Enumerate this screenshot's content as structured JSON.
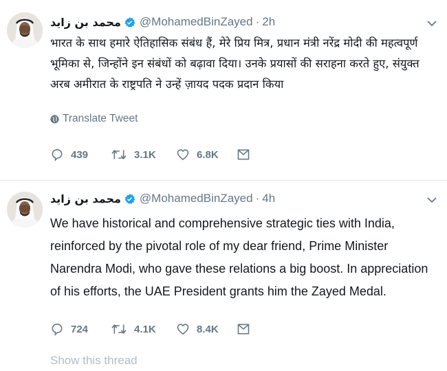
{
  "tweets": [
    {
      "name": "محمد بن زايد",
      "handle": "@MohamedBinZayed",
      "time": "2h",
      "text": "भारत के साथ हमारे ऐतिहासिक संबंध हैं, मेरे प्रिय मित्र, प्रधान मंत्री नरेंद्र मोदी की महत्वपूर्ण भूमिका से, जिन्होंने इन संबंधों को बढ़ावा दिया। उनके प्रयासों की सराहना करते हुए, संयुक्त अरब अमीरात के राष्ट्रपति ने उन्हें ज़ायद पदक प्रदान किया",
      "translate_label": "Translate Tweet",
      "replies": "439",
      "retweets": "3.1K",
      "likes": "6.8K"
    },
    {
      "name": "محمد بن زايد",
      "handle": "@MohamedBinZayed",
      "time": "4h",
      "text": "We have historical and comprehensive strategic ties with India, reinforced by the pivotal role of my dear friend, Prime Minister Narendra Modi, who gave these relations a big boost. In appreciation of his efforts, the UAE President grants him the Zayed Medal.",
      "replies": "724",
      "retweets": "4.1K",
      "likes": "8.4K"
    }
  ],
  "show_thread_label": "Show this thread",
  "colors": {
    "text": "#14171a",
    "secondary": "#657786",
    "verified": "#1da1f2",
    "divider": "#e1e8ed"
  },
  "icons": [
    "avatar",
    "verified-badge-icon",
    "chevron-down-icon",
    "globe-icon",
    "reply-icon",
    "retweet-icon",
    "like-icon",
    "share-icon"
  ]
}
